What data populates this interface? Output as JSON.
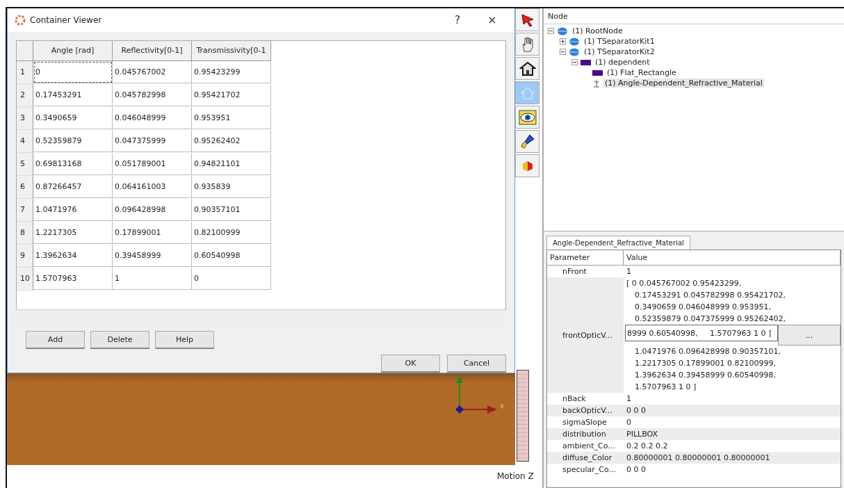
{
  "dialog": {
    "title": "Container Viewer",
    "help_button": "?",
    "close_button": "×",
    "table": {
      "columns": [
        "Angle [rad]",
        "Reflectivity[0-1]",
        "Transmissivity[0-1"
      ],
      "rows": [
        {
          "number": "1",
          "cells": [
            "0",
            "0.045767002",
            "0.95423299"
          ],
          "focused": true
        },
        {
          "number": "2",
          "cells": [
            "0.17453291",
            "0.045782998",
            "0.95421702"
          ],
          "focused": false
        },
        {
          "number": "3",
          "cells": [
            "0.3490659",
            "0.046048999",
            "0.953951"
          ],
          "focused": false
        },
        {
          "number": "4",
          "cells": [
            "0.52359879",
            "0.047375999",
            "0.95262402"
          ],
          "focused": false
        },
        {
          "number": "5",
          "cells": [
            "0.69813168",
            "0.051789001",
            "0.94821101"
          ],
          "focused": false
        },
        {
          "number": "6",
          "cells": [
            "0.87266457",
            "0.064161003",
            "0.935839"
          ],
          "focused": false
        },
        {
          "number": "7",
          "cells": [
            "1.0471976",
            "0.096428998",
            "0.90357101"
          ],
          "focused": false
        },
        {
          "number": "8",
          "cells": [
            "1.2217305",
            "0.17899001",
            "0.82100999"
          ],
          "focused": false
        },
        {
          "number": "9",
          "cells": [
            "1.3962634",
            "0.39458999",
            "0.60540998"
          ],
          "focused": false
        },
        {
          "number": "10",
          "cells": [
            "1.5707963",
            "1",
            "0"
          ],
          "focused": false
        }
      ]
    },
    "edit_buttons": [
      "Add",
      "Delete",
      "Help"
    ],
    "ok_button": "OK",
    "cancel_button": "Cancel"
  },
  "viewport": {
    "axis_label": "x",
    "motion_label": "Motion Z"
  },
  "toolbar": [
    {
      "kind": "pointer",
      "selected": false
    },
    {
      "kind": "hand",
      "selected": false
    },
    {
      "kind": "house",
      "selected": false
    },
    {
      "kind": "home",
      "selected": true
    },
    {
      "kind": "eye",
      "selected": false
    },
    {
      "kind": "flashlight",
      "selected": false
    },
    {
      "kind": "cube",
      "selected": false
    }
  ],
  "tree": {
    "header": "Node",
    "items": [
      {
        "label": "(1) RootNode",
        "kind": "sphere",
        "expanded": true,
        "selected": false,
        "children": [
          {
            "label": "(1) TSeparatorKit1",
            "kind": "sphere",
            "expanded": false,
            "selected": false
          },
          {
            "label": "(1) TSeparatorKit2",
            "kind": "sphere",
            "expanded": true,
            "selected": false,
            "children": [
              {
                "label": "(1) dependent",
                "kind": "shape",
                "expanded": true,
                "selected": false,
                "children": [
                  {
                    "label": "(1) Flat_Rectangle",
                    "kind": "shape",
                    "selected": false
                  },
                  {
                    "label": "(1) Angle-Dependent_Refractive_Material",
                    "kind": "material",
                    "selected": true
                  }
                ]
              }
            ]
          }
        ]
      }
    ]
  },
  "properties": {
    "tab": "Angle-Dependent_Refractive_Material",
    "columns": [
      "Parameter",
      "Value"
    ],
    "rows": [
      {
        "kind": "text",
        "name": "nFront",
        "value": "1"
      },
      {
        "kind": "editing",
        "name": "frontOpticV...",
        "lines_before": [
          "[ 0 0.045767002 0.95423299,",
          "0.17453291 0.045782998 0.95421702,",
          "0.3490659 0.046048999 0.953951,",
          "0.52359879 0.047375999 0.95262402,"
        ],
        "edit_value": "8999 0.60540998,     1.5707963 1 0 ]",
        "edit_button": "...",
        "lines_after": [
          "1.0471976 0.096428998 0.90357101,",
          "1.2217305 0.17899001 0.82100999,",
          "1.3962634 0.39458999 0.60540998,",
          "1.5707963 1 0 ]"
        ]
      },
      {
        "kind": "text",
        "name": "nBack",
        "value": "1"
      },
      {
        "kind": "text",
        "name": "backOpticV...",
        "value": "0 0 0"
      },
      {
        "kind": "text",
        "name": "sigmaSlope",
        "value": "0"
      },
      {
        "kind": "text",
        "name": "distribution",
        "value": "PILLBOX"
      },
      {
        "kind": "text",
        "name": "ambient_Co...",
        "value": "0.2 0.2 0.2"
      },
      {
        "kind": "text",
        "name": "diffuse_Color",
        "value": "0.80000001 0.80000001 0.80000001"
      },
      {
        "kind": "text",
        "name": "specular_Co...",
        "value": "0 0 0"
      }
    ]
  }
}
